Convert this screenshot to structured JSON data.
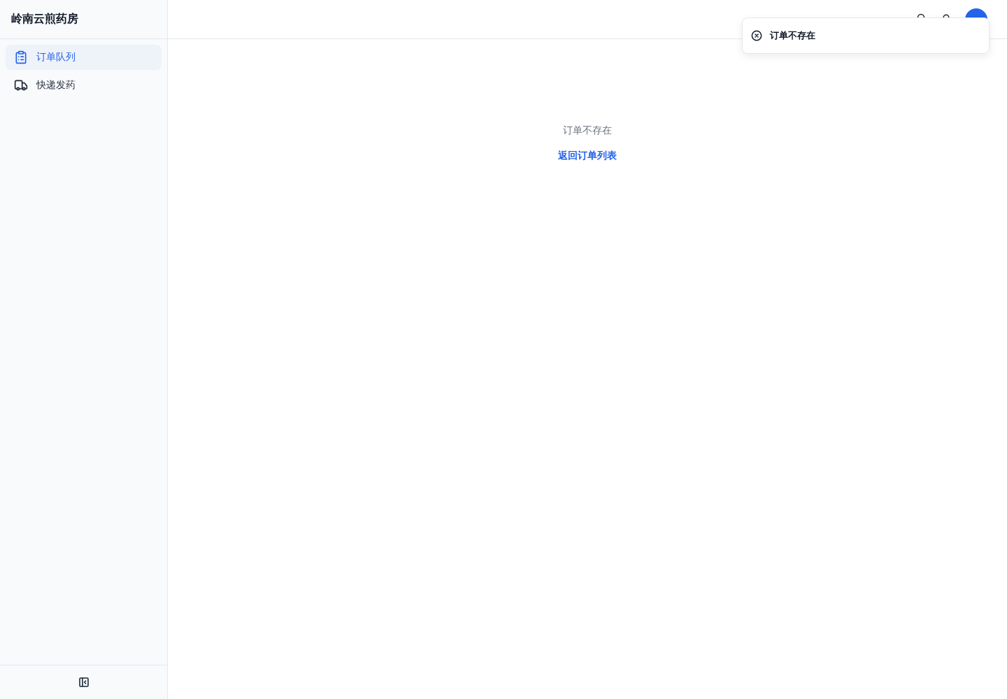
{
  "sidebar": {
    "title": "岭南云煎药房",
    "items": [
      {
        "label": "订单队列",
        "selected": true
      },
      {
        "label": "快递发药",
        "selected": false
      }
    ]
  },
  "empty_state": {
    "message": "订单不存在",
    "link": "返回订单列表"
  },
  "toast": {
    "kind": "error",
    "message": "订单不存在"
  }
}
